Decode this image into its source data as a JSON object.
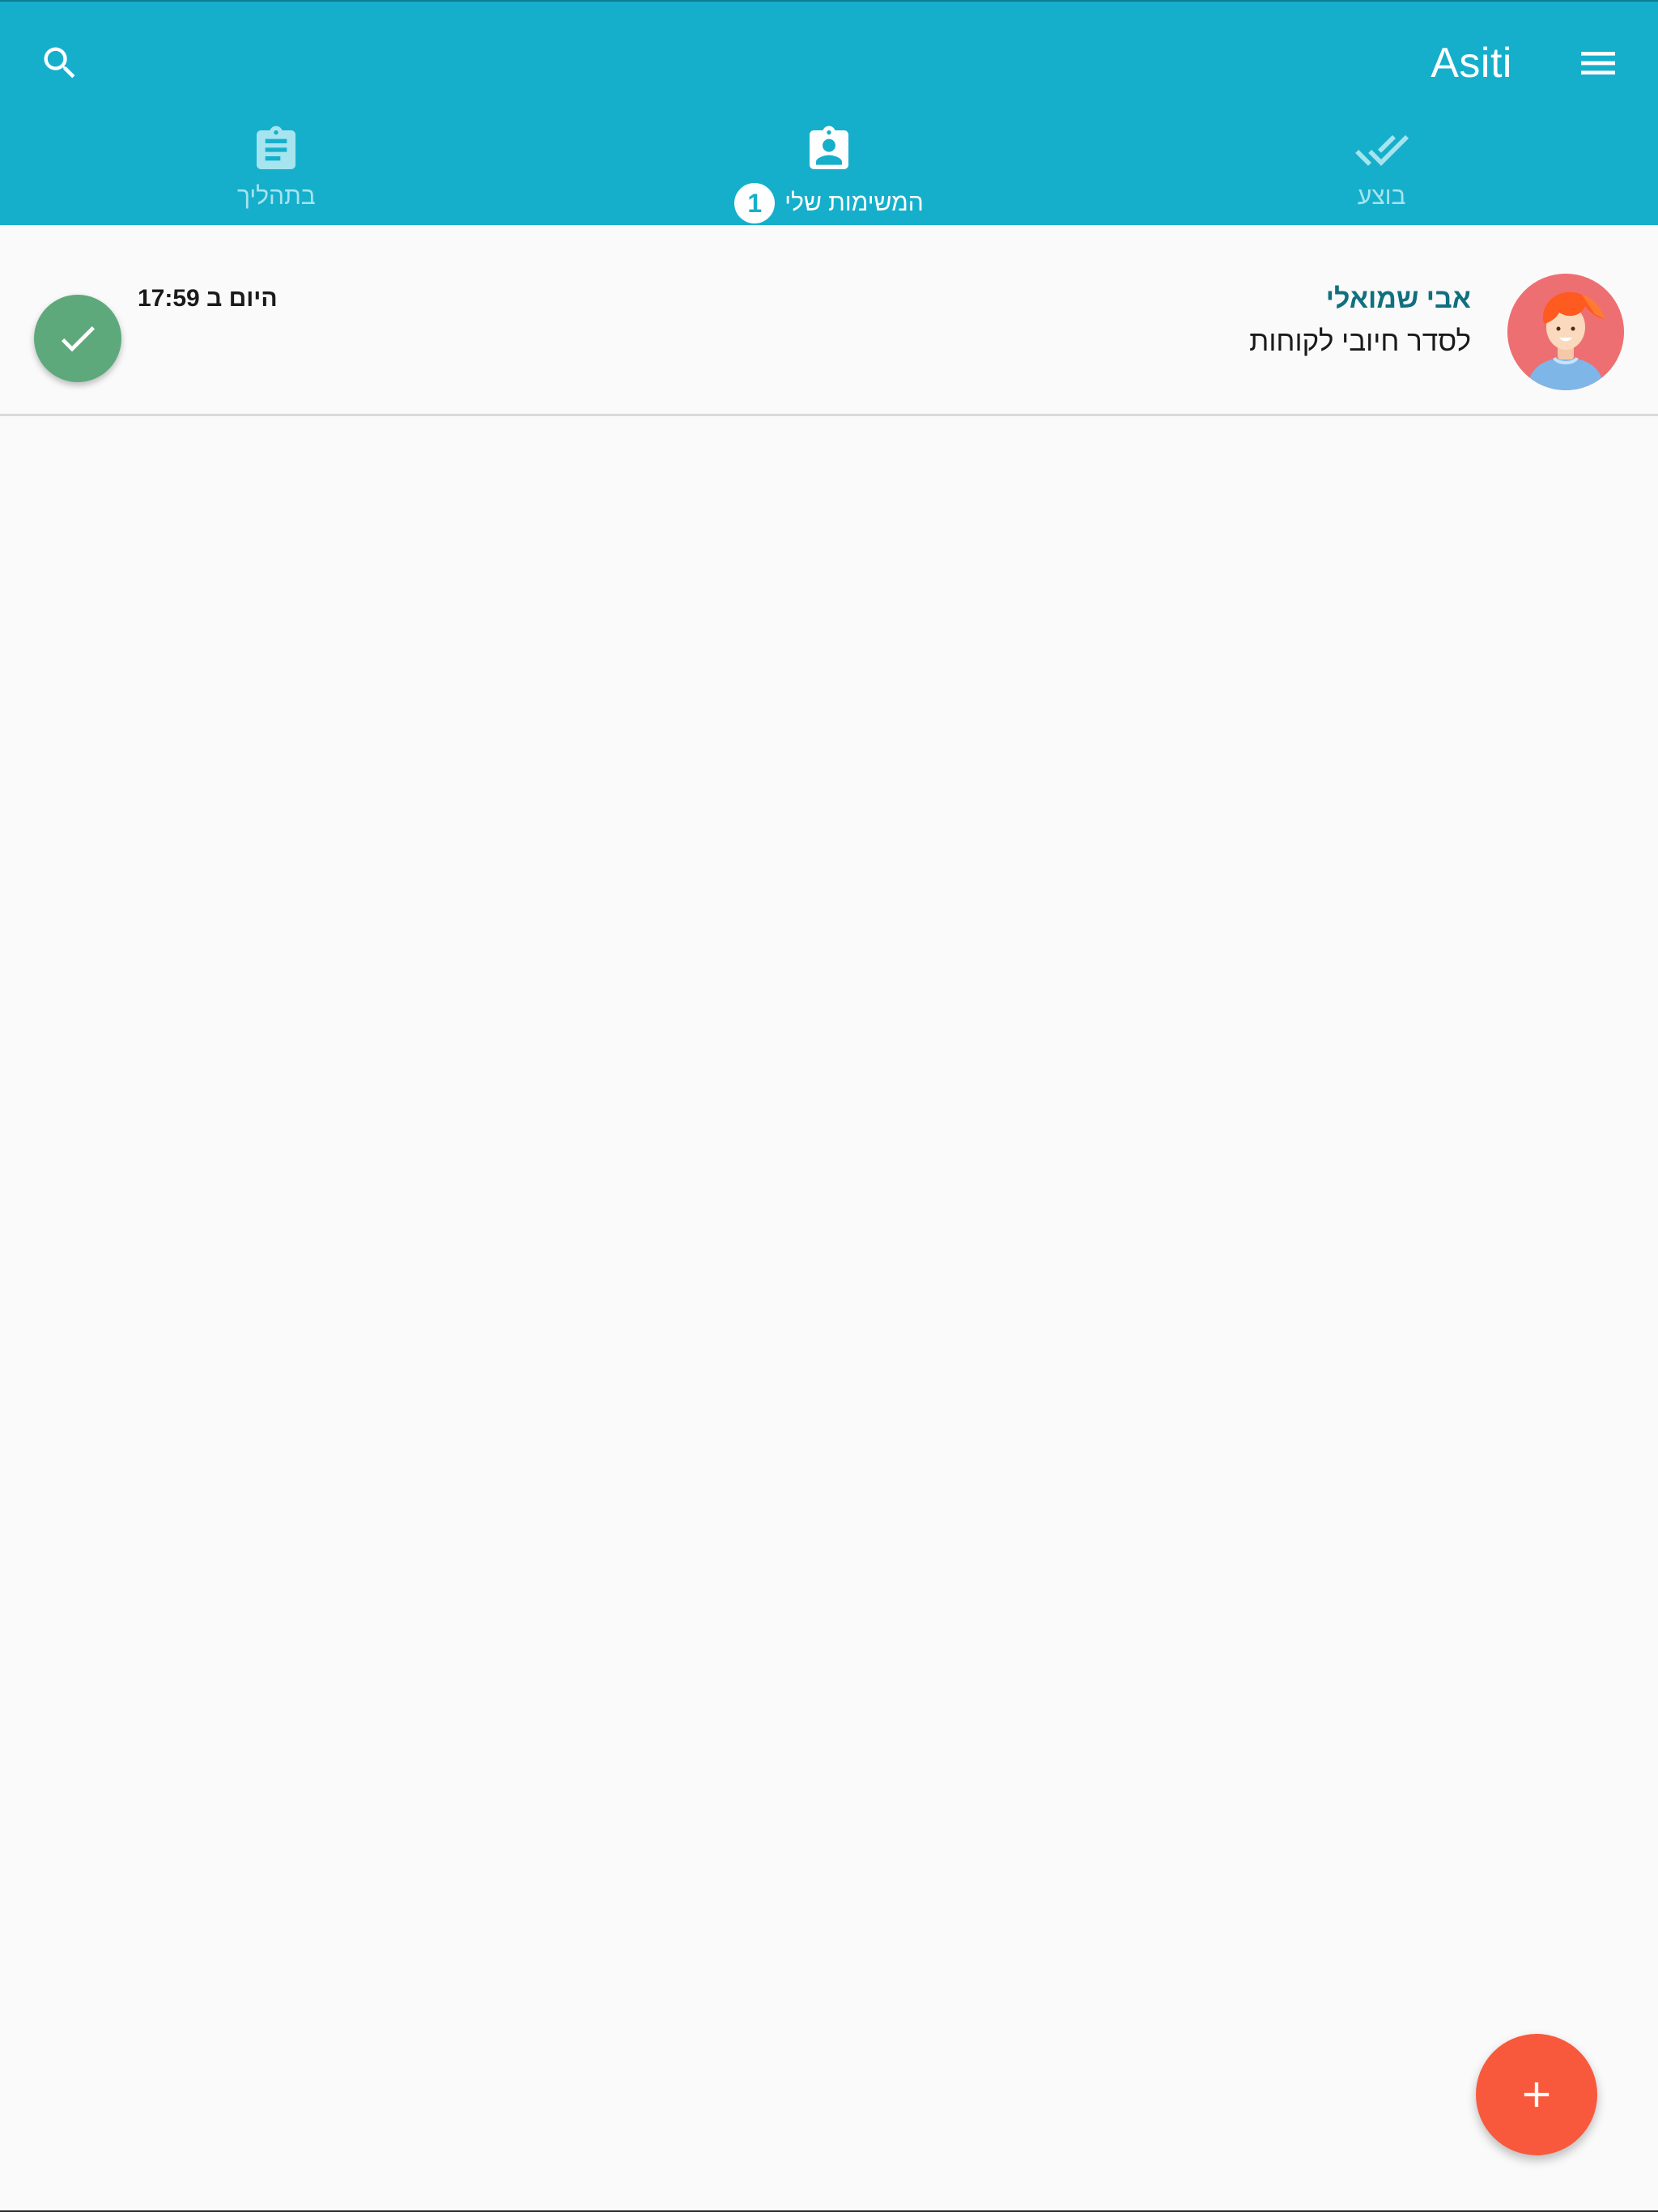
{
  "header": {
    "app_title": "Asiti",
    "search_icon": "search-icon",
    "menu_icon": "menu-icon",
    "background_color": "#16afcb"
  },
  "tabs": [
    {
      "label": "בוצע",
      "icon": "done-all-icon",
      "active": false
    },
    {
      "label": "המשימות שלי",
      "icon": "assignment-ind-icon",
      "active": true,
      "badge": "1"
    },
    {
      "label": "בתהליך",
      "icon": "assignment-icon",
      "active": false
    }
  ],
  "tasks": [
    {
      "assignee": "אבי שמואלי",
      "title": "לסדר חיובי לקוחות",
      "time": "היום ב 17:59",
      "avatar_icon": "avatar-icon",
      "complete_icon": "check-icon",
      "complete_color": "#5ea97b"
    }
  ],
  "fab": {
    "icon": "plus-icon",
    "label": "+",
    "color": "#f8593c"
  }
}
